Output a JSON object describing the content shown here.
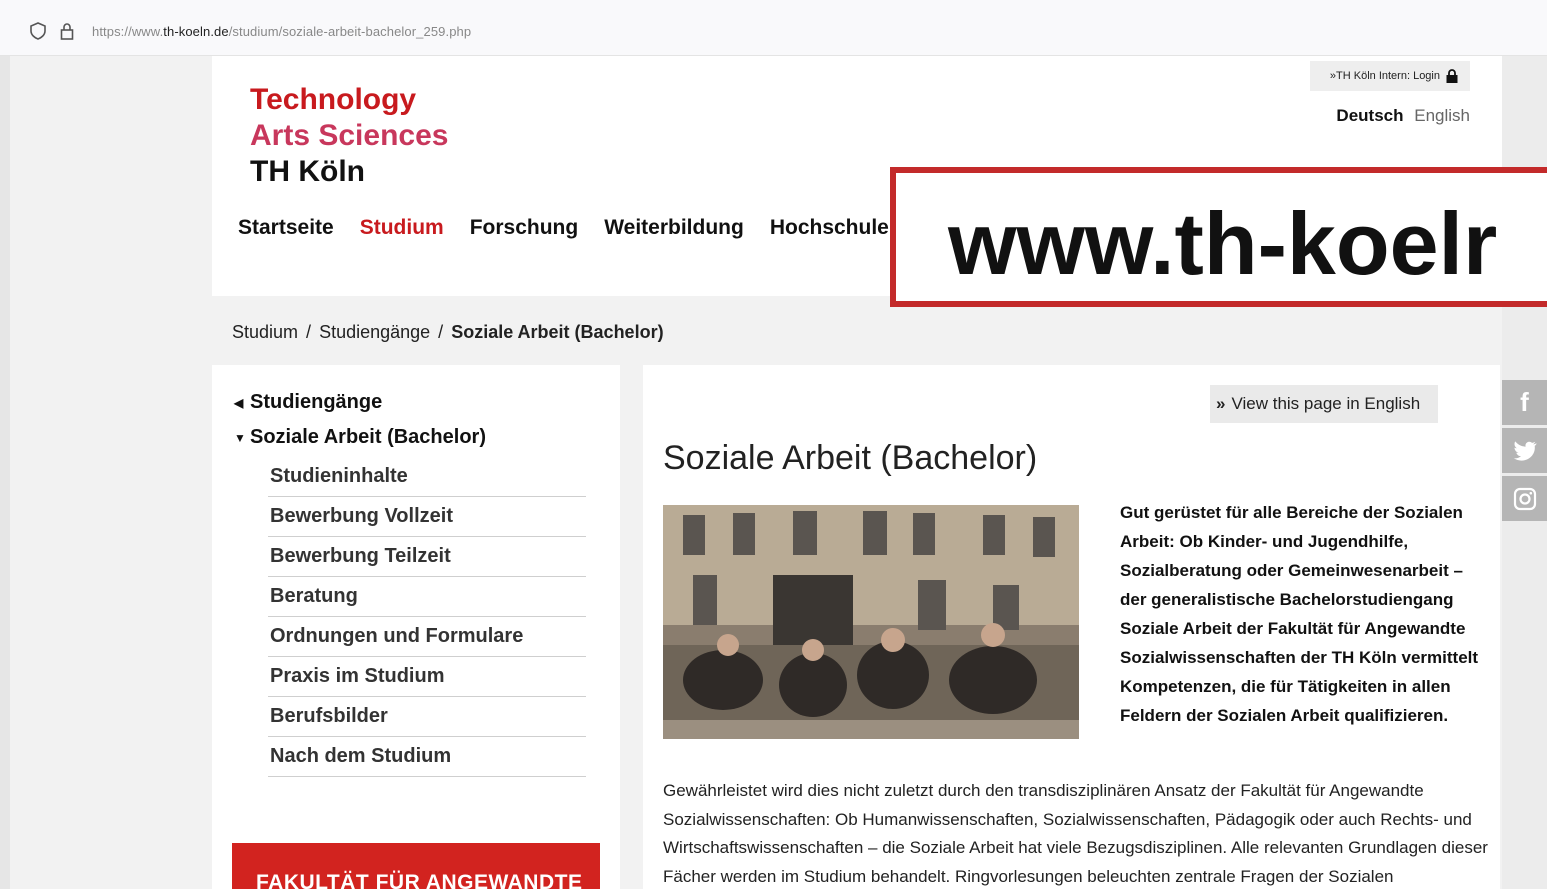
{
  "browser": {
    "url_prefix": "https://www.",
    "url_domain": "th-koeln.de",
    "url_path": "/studium/soziale-arbeit-bachelor_259.php"
  },
  "header": {
    "logo": [
      "Technology",
      "Arts Sciences",
      "TH Köln"
    ],
    "login": "»TH Köln Intern: Login",
    "lang_de": "Deutsch",
    "lang_en": "English",
    "nav": [
      "Startseite",
      "Studium",
      "Forschung",
      "Weiterbildung",
      "Hochschule"
    ],
    "nav_active": "Studium"
  },
  "overlay_text": "www.th-koelr",
  "breadcrumb": [
    "Studium",
    "Studiengänge",
    "Soziale Arbeit (Bachelor)"
  ],
  "sidenav": {
    "parent": "Studiengänge",
    "current": "Soziale Arbeit (Bachelor)",
    "items": [
      "Studieninhalte",
      "Bewerbung Vollzeit",
      "Bewerbung Teilzeit",
      "Beratung",
      "Ordnungen und Formulare",
      "Praxis im Studium",
      "Berufsbilder",
      "Nach dem Studium"
    ],
    "faculty_box": "FAKULTÄT FÜR ANGEWANDTE"
  },
  "main": {
    "view_english": "View this page in English",
    "title": "Soziale Arbeit (Bachelor)",
    "intro": "Gut gerüstet für alle Bereiche der Sozialen Arbeit: Ob Kinder- und Jugendhilfe, Sozialberatung oder Gemeinwesenarbeit – der generalistische Bachelorstudiengang Soziale Arbeit der Fakultät für Angewandte Sozialwissenschaften der TH Köln vermittelt Kompetenzen, die für Tätigkeiten in allen Feldern der Sozialen Arbeit qualifizieren.",
    "body": "Gewährleistet wird dies nicht zuletzt durch den transdisziplinären Ansatz der Fakultät für Angewandte Sozialwissenschaften: Ob Humanwissenschaften, Sozialwissenschaften, Pädagogik oder auch Rechts- und Wirtschaftswissenschaften – die Soziale Arbeit hat viele Bezugsdisziplinen. Alle relevanten Grundlagen dieser Fächer werden im Studium behandelt. Ringvorlesungen beleuchten zentrale Fragen der Sozialen"
  },
  "social": [
    "f",
    "twitter",
    "instagram"
  ]
}
